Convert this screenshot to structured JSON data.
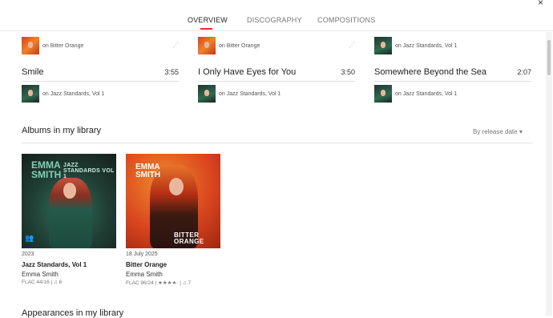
{
  "tabs": [
    {
      "label": "OVERVIEW",
      "active": true
    },
    {
      "label": "DISCOGRAPHY",
      "active": false
    },
    {
      "label": "COMPOSITIONS",
      "active": false
    }
  ],
  "colors": {
    "accent": "#e0322d"
  },
  "tracks_top_row": [
    {
      "on_text": "on Bitter Orange",
      "cover": "orange"
    },
    {
      "on_text": "on Bitter Orange",
      "cover": "orange"
    },
    {
      "on_text": "on Jazz Standards, Vol 1",
      "cover": "green"
    }
  ],
  "tracks": [
    {
      "title": "Smile",
      "duration": "3:55",
      "on_text": "on Jazz Standards, Vol 1",
      "cover": "green"
    },
    {
      "title": "I Only Have Eyes for You",
      "duration": "3:50",
      "on_text": "on Jazz Standards, Vol 1",
      "cover": "green"
    },
    {
      "title": "Somewhere Beyond the Sea",
      "duration": "2:07",
      "on_text": "on Jazz Standards, Vol 1",
      "cover": "green"
    }
  ],
  "albums_section": {
    "title": "Albums in my library",
    "sort_label": "By release date",
    "albums": [
      {
        "year": "2023",
        "title": "Jazz Standards, Vol 1",
        "artist": "Emma Smith",
        "meta": "FLAC 44/16 | ♫ 6",
        "cover_name": "EMMA SMITH",
        "cover_subtitle": "JAZZ STANDARDS VOL 1"
      },
      {
        "year": "18 July 2025",
        "title": "Bitter Orange",
        "artist": "Emma Smith",
        "meta": "FLAC 96/24 | ★★★★· | ♫ 7",
        "cover_name": "EMMA SMITH",
        "cover_subtitle": "BITTER ORANGE"
      }
    ]
  },
  "appearances_section": {
    "title": "Appearances in my library"
  },
  "icons": {
    "close": "close-icon",
    "drag": "drag-handle-icon",
    "users": "users-icon",
    "chevron": "chevron-down-icon"
  }
}
